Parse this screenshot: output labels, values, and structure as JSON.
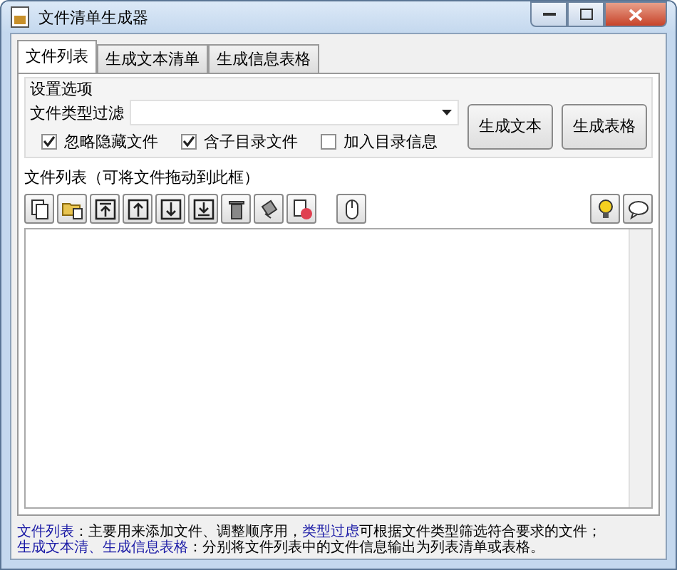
{
  "window": {
    "title": "文件清单生成器"
  },
  "tabs": [
    {
      "label": "文件列表",
      "selected": true
    },
    {
      "label": "生成文本清单",
      "selected": false
    },
    {
      "label": "生成信息表格",
      "selected": false
    }
  ],
  "options": {
    "title": "设置选项",
    "filter_label": "文件类型过滤",
    "checkboxes": [
      {
        "label": "忽略隐藏文件",
        "checked": true
      },
      {
        "label": "含子目录文件",
        "checked": true
      },
      {
        "label": "加入目录信息",
        "checked": false
      }
    ],
    "buttons": [
      "生成文本",
      "生成表格"
    ]
  },
  "file_list": {
    "title": "文件列表（可将文件拖动到此框）",
    "toolbar": [
      {
        "kind": "copy"
      },
      {
        "kind": "folder"
      },
      {
        "kind": "top"
      },
      {
        "kind": "up"
      },
      {
        "kind": "down"
      },
      {
        "kind": "bottom"
      },
      {
        "kind": "trash"
      },
      {
        "kind": "broom"
      },
      {
        "kind": "remove"
      },
      {
        "kind": "gap"
      },
      {
        "kind": "mouse"
      }
    ],
    "toolbar_right": [
      {
        "kind": "bulb"
      },
      {
        "kind": "chat"
      }
    ]
  },
  "help": [
    [
      {
        "kind": "link",
        "text": "文件列表"
      },
      {
        "kind": "text",
        "text": "：主要用来添加文件、调整顺序用，"
      },
      {
        "kind": "link",
        "text": "类型过虑"
      },
      {
        "kind": "text",
        "text": "可根据文件类型筛选符合要求的文件；"
      }
    ],
    [
      {
        "kind": "link",
        "text": "生成文本清、生成信息表格"
      },
      {
        "kind": "text",
        "text": "：分别将文件列表中的文件信息输出为列表清单或表格。"
      }
    ]
  ]
}
